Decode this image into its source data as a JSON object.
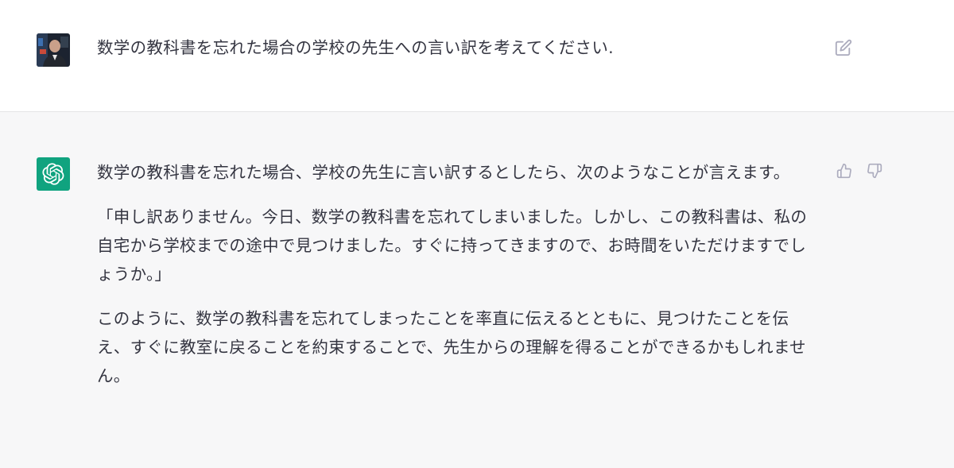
{
  "conversation": {
    "user_message": {
      "avatar_icon": "user-photo-avatar",
      "text": "数学の教科書を忘れた場合の学校の先生への言い訳を考えてください.",
      "action_icon": "edit-icon"
    },
    "assistant_message": {
      "avatar_icon": "openai-logo-icon",
      "brand_color": "#10a37f",
      "paragraphs": [
        "数学の教科書を忘れた場合、学校の先生に言い訳するとしたら、次のようなことが言えます。",
        "「申し訳ありません。今日、数学の教科書を忘れてしまいました。しかし、この教科書は、私の自宅から学校までの途中で見つけました。すぐに持ってきますので、お時間をいただけますでしょうか。」",
        "このように、数学の教科書を忘れてしまったことを率直に伝えるとともに、見つけたことを伝え、すぐに教室に戻ることを約束することで、先生からの理解を得ることができるかもしれません。"
      ],
      "action_icons": [
        "thumbs-up-icon",
        "thumbs-down-icon"
      ]
    }
  }
}
